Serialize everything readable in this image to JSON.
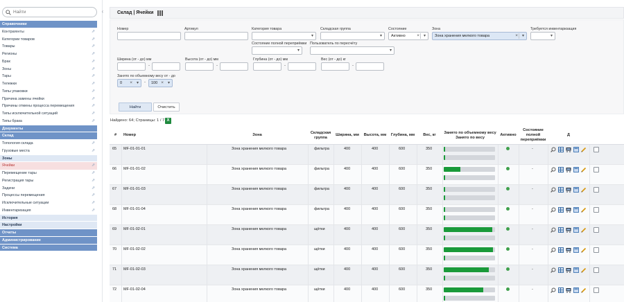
{
  "sidebar": {
    "search_placeholder": "Найти",
    "items": [
      {
        "label": "Справочники",
        "kind": "cat",
        "ext": false
      },
      {
        "label": "Контрагенты",
        "kind": "sub",
        "ext": true
      },
      {
        "label": "Категории товаров",
        "kind": "sub",
        "ext": true
      },
      {
        "label": "Товары",
        "kind": "sub",
        "ext": true
      },
      {
        "label": "Регионы",
        "kind": "sub",
        "ext": true
      },
      {
        "label": "Брак",
        "kind": "sub",
        "ext": true
      },
      {
        "label": "Зоны",
        "kind": "sub",
        "ext": true
      },
      {
        "label": "Тары",
        "kind": "sub",
        "ext": true
      },
      {
        "label": "Тележки",
        "kind": "sub",
        "ext": true
      },
      {
        "label": "Типы упаковки",
        "kind": "sub",
        "ext": true
      },
      {
        "label": "Причина замены ячейки",
        "kind": "sub",
        "ext": true
      },
      {
        "label": "Причины отмены процесса перемещения",
        "kind": "sub",
        "ext": true
      },
      {
        "label": "Типы исключительной ситуаций",
        "kind": "sub",
        "ext": true
      },
      {
        "label": "Типы брака",
        "kind": "sub",
        "ext": true
      },
      {
        "label": "Документы",
        "kind": "cat",
        "ext": false
      },
      {
        "label": "Склад",
        "kind": "cat",
        "ext": false
      },
      {
        "label": "Топология склада",
        "kind": "sub",
        "ext": true
      },
      {
        "label": "Грузовые места",
        "kind": "sub",
        "ext": true
      },
      {
        "label": "Зоны",
        "kind": "cat-light",
        "ext": false
      },
      {
        "label": "Ячейки",
        "kind": "sub-active",
        "ext": true
      },
      {
        "label": "Перемещение тары",
        "kind": "sub",
        "ext": true
      },
      {
        "label": "Регистрация тары",
        "kind": "sub",
        "ext": true
      },
      {
        "label": "Задачи",
        "kind": "sub",
        "ext": true
      },
      {
        "label": "Процессы перемещения",
        "kind": "sub",
        "ext": true
      },
      {
        "label": "Исключительные ситуации",
        "kind": "sub",
        "ext": true
      },
      {
        "label": "Инвентаризация",
        "kind": "sub",
        "ext": true
      },
      {
        "label": "История",
        "kind": "cat-light",
        "ext": false
      },
      {
        "label": "Настройки",
        "kind": "cat-light",
        "ext": false
      },
      {
        "label": "Отчеты",
        "kind": "cat",
        "ext": false
      },
      {
        "label": "Администрирование",
        "kind": "cat",
        "ext": false
      },
      {
        "label": "Система",
        "kind": "cat",
        "ext": false
      }
    ]
  },
  "header": {
    "title": "Склад  |  Ячейки"
  },
  "filters": {
    "number_label": "Номер",
    "article_label": "Артикул",
    "category_label": "Категория товара",
    "group_label": "Складская группа",
    "state_label": "Состояние",
    "state_value": "Активно",
    "zone_label": "Зона",
    "zone_value": "Зона хранения мелкого товара",
    "inventory_label": "Требуется инвентаризация",
    "fill_state_label": "Состояние полной переприёмки",
    "recalc_user_label": "Пользователь по пересчёту",
    "width_label": "Ширина (от - до) мм",
    "height_label": "Высота (от - до) мм",
    "depth_label": "Глубина (от - до) мм",
    "weight_label": "Вес (от - до) кг",
    "occupied_label": "Занято по объемному весу от - до",
    "occupied_from": "0",
    "occupied_to": "100",
    "find_label": "Найти",
    "clear_label": "Очистить"
  },
  "results": {
    "found_text": "Найдено: 64; Страницы: 1 / 7",
    "excel_glyph": "X"
  },
  "table": {
    "headers": {
      "idx": "#",
      "number": "Номер",
      "zone": "Зона",
      "group": "Складская группа",
      "width": "Ширина, мм",
      "height": "Высота, мм",
      "depth": "Глубина, мм",
      "weight": "Вес, кг",
      "occupied": "Занято по объемному весу",
      "occupied2": "Занято по весу",
      "active": "Активно",
      "fullstate": "Состояние полной переприёмки",
      "actions": "Д"
    },
    "rows": [
      {
        "idx": "65",
        "number": "MF-01-01-01",
        "zone": "Зона хранения мелкого товара",
        "group": "фильтра",
        "width": "400",
        "height": "400",
        "depth": "600",
        "weight": "350",
        "occ_volume": 0.0,
        "occ_weight": 0.0,
        "fullstate": "-"
      },
      {
        "idx": "66",
        "number": "MF-01-01-02",
        "zone": "Зона хранения мелкого товара",
        "group": "фильтра",
        "width": "400",
        "height": "400",
        "depth": "600",
        "weight": "350",
        "occ_volume": 0.32,
        "occ_weight": 0.0,
        "fullstate": "-"
      },
      {
        "idx": "67",
        "number": "MF-01-01-03",
        "zone": "Зона хранения мелкого товара",
        "group": "фильтра",
        "width": "400",
        "height": "400",
        "depth": "600",
        "weight": "350",
        "occ_volume": 0.0,
        "occ_weight": 0.0,
        "fullstate": "-"
      },
      {
        "idx": "68",
        "number": "MF-01-01-04",
        "zone": "Зона хранения мелкого товара",
        "group": "фильтра",
        "width": "400",
        "height": "400",
        "depth": "600",
        "weight": "350",
        "occ_volume": 0.0,
        "occ_weight": 0.0,
        "fullstate": "-"
      },
      {
        "idx": "69",
        "number": "MF-01-02-01",
        "zone": "Зона хранения мелкого товара",
        "group": "щётки",
        "width": "400",
        "height": "400",
        "depth": "600",
        "weight": "350",
        "occ_volume": 0.94,
        "occ_weight": 0.0,
        "fullstate": "-"
      },
      {
        "idx": "70",
        "number": "MF-01-02-02",
        "zone": "Зона хранения мелкого товара",
        "group": "щётки",
        "width": "400",
        "height": "400",
        "depth": "600",
        "weight": "350",
        "occ_volume": 0.96,
        "occ_weight": 0.0,
        "fullstate": "-"
      },
      {
        "idx": "71",
        "number": "MF-01-02-03",
        "zone": "Зона хранения мелкого товара",
        "group": "щётки",
        "width": "400",
        "height": "400",
        "depth": "600",
        "weight": "350",
        "occ_volume": 0.88,
        "occ_weight": 0.0,
        "fullstate": "-"
      },
      {
        "idx": "72",
        "number": "MF-01-02-04",
        "zone": "Зона хранения мелкого товара",
        "group": "щётки",
        "width": "400",
        "height": "400",
        "depth": "600",
        "weight": "350",
        "occ_volume": 0.77,
        "occ_weight": 0.0,
        "fullstate": "-"
      }
    ]
  },
  "icons": [
    "search-icon",
    "grid-icon",
    "external-link-icon",
    "magnifier-icon",
    "table-icon",
    "cart-icon",
    "window-icon",
    "pencil-icon",
    "excel-icon"
  ]
}
